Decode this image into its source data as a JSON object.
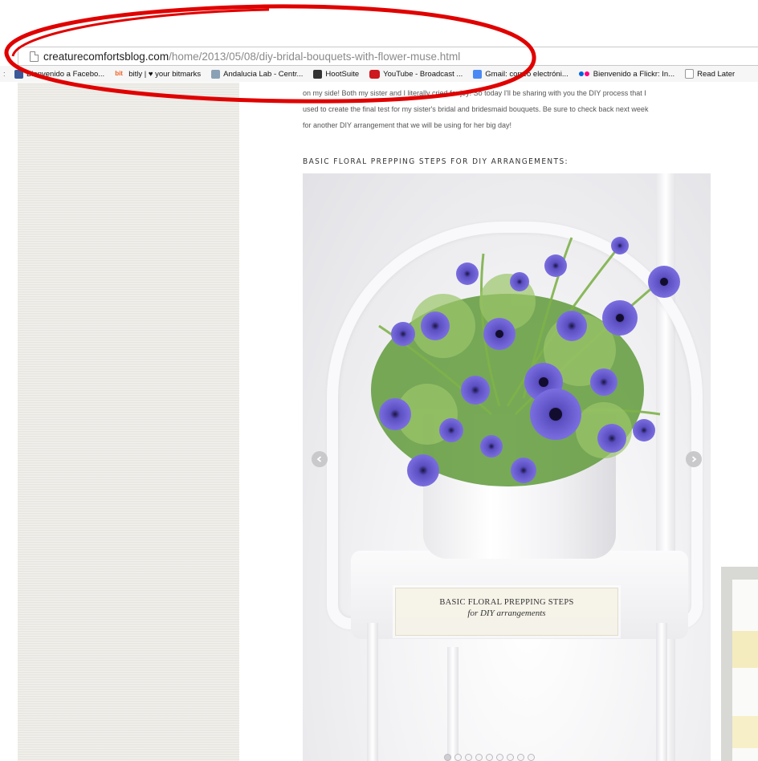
{
  "browser": {
    "url_domain": "creaturecomfortsblog.com",
    "url_path": "/home/2013/05/08/diy-bridal-bouquets-with-flower-muse.html"
  },
  "bookmarks": [
    {
      "label": "Bienvenido a Facebo...",
      "icon": "facebook-icon",
      "color": "#3b5998"
    },
    {
      "label": "bitly | ♥ your bitmarks",
      "icon": "bitly-icon",
      "color": "#ee6123"
    },
    {
      "label": "Andalucia Lab - Centr...",
      "icon": "andalucia-lab-icon",
      "color": "#8aa0b4"
    },
    {
      "label": "HootSuite",
      "icon": "hootsuite-icon",
      "color": "#333333"
    },
    {
      "label": "YouTube - Broadcast ...",
      "icon": "youtube-icon",
      "color": "#cc181e"
    },
    {
      "label": "Gmail: correo electróni...",
      "icon": "gmail-icon",
      "color": "#4a8af4"
    },
    {
      "label": "Bienvenido a Flickr: In...",
      "icon": "flickr-icon",
      "color": "#ff0084"
    },
    {
      "label": "Read Later",
      "icon": "folder-icon",
      "color": "#ffffff"
    }
  ],
  "article": {
    "intro_lines": [
      "on my side! Both my sister and I literally cried for joy! So today I'll be sharing with you the DIY process that I",
      "used to create the final test for my sister's bridal and bridesmaid bouquets. Be sure to check back next week",
      "for another DIY arrangement that we will be using for her big day!"
    ],
    "section_heading": "BASIC FLORAL PREPPING STEPS FOR DIY ARRANGEMENTS:",
    "slide_caption_title": "BASIC FLORAL PREPPING STEPS",
    "slide_caption_subtitle": "for DIY arrangements",
    "slide_count": 9,
    "slide_active": 1
  },
  "annotation": {
    "color": "#e00000"
  }
}
